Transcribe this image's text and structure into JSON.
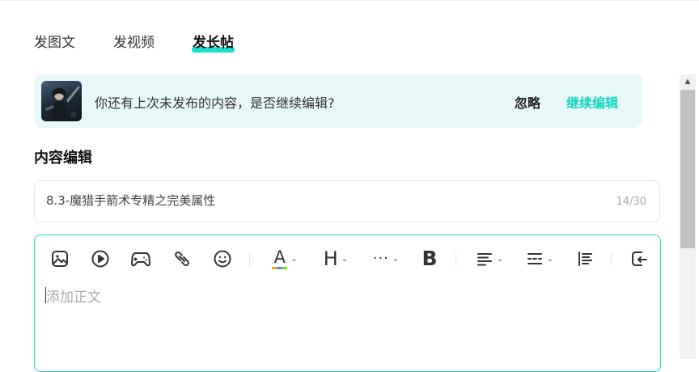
{
  "tabs": [
    {
      "label": "发图文",
      "active": false
    },
    {
      "label": "发视频",
      "active": false
    },
    {
      "label": "发长帖",
      "active": true
    }
  ],
  "draft_banner": {
    "message": "你还有上次未发布的内容，是否继续编辑?",
    "ignore_label": "忽略",
    "continue_label": "继续编辑"
  },
  "content_section": {
    "title": "内容编辑"
  },
  "title_input": {
    "value": "8.3-魔猎手箭术专精之完美属性",
    "counter": "14/30"
  },
  "editor": {
    "toolbar": [
      {
        "icon": "image-icon"
      },
      {
        "icon": "video-icon"
      },
      {
        "icon": "gamepad-icon"
      },
      {
        "icon": "link-icon"
      },
      {
        "icon": "emoji-icon"
      },
      {
        "icon": "font-color-icon",
        "glyph": "A"
      },
      {
        "icon": "heading-icon",
        "glyph": "H"
      },
      {
        "icon": "more-icon",
        "glyph": "···"
      },
      {
        "icon": "bold-icon",
        "glyph": "B"
      },
      {
        "icon": "align-icon"
      },
      {
        "icon": "line-spacing-icon"
      },
      {
        "icon": "blockquote-icon"
      },
      {
        "icon": "redo-icon"
      }
    ],
    "body_placeholder": "添加正文"
  },
  "colors": {
    "accent": "#1ee0cf",
    "accent_text": "#17d3c4",
    "banner_bg": "#e6f8f7"
  }
}
